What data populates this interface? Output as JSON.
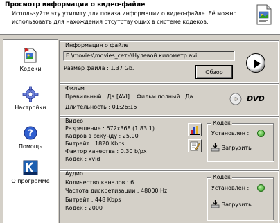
{
  "header": {
    "title": "Просмотр информации о видео-файле",
    "description": "Используйте эту утилиту для показа информации о видео-файле. Её можно использовать для нахождения отсутствующих в системе кодеков."
  },
  "sidebar": {
    "items": [
      {
        "label": "Кодеки",
        "icon": "codecs-icon"
      },
      {
        "label": "Настройки",
        "icon": "settings-gear-icon"
      },
      {
        "label": "Помощь",
        "icon": "help-icon"
      },
      {
        "label": "О программе",
        "icon": "about-k-icon"
      }
    ]
  },
  "file_info": {
    "title": "Информация о файле",
    "path": "E:\\movies\\movies_сеть\\Нулевой километр.avi",
    "size_label": "Размер файла : 1.37 Gb.",
    "browse_button": "Обзор"
  },
  "film": {
    "title": "Фильм",
    "correct": "Правильный : Да [AVI]",
    "full": "Фильм полный : Да",
    "duration": "Длительность : 01:26:15",
    "badge": "DVD"
  },
  "video": {
    "title": "Видео",
    "resolution": "Разрешение : 672x368 (1.83:1)",
    "fps": "Кадров в секунду : 25.00",
    "bitrate": "Битрейт : 1820 Kbps",
    "quality": "Фактор качества : 0.30 b/px",
    "codec": "Кодек : xvid",
    "codec_box_title": "Кодек",
    "installed_label": "Установлен :",
    "download_button": "Загрузить"
  },
  "audio": {
    "title": "Аудио",
    "channels": "Количество каналов : 6",
    "sample_rate": "Частота дискретизации : 48000 Hz",
    "bitrate": "Битрейт : 448 Kbps",
    "codec": "Кодек : 2000",
    "codec_box_title": "Кодек",
    "installed_label": "Установлен :",
    "download_button": "Загрузить"
  },
  "colors": {
    "panel": "#d4d0c8",
    "window_bg": "#ffffff",
    "installed_ok": "#2e9a1e"
  }
}
